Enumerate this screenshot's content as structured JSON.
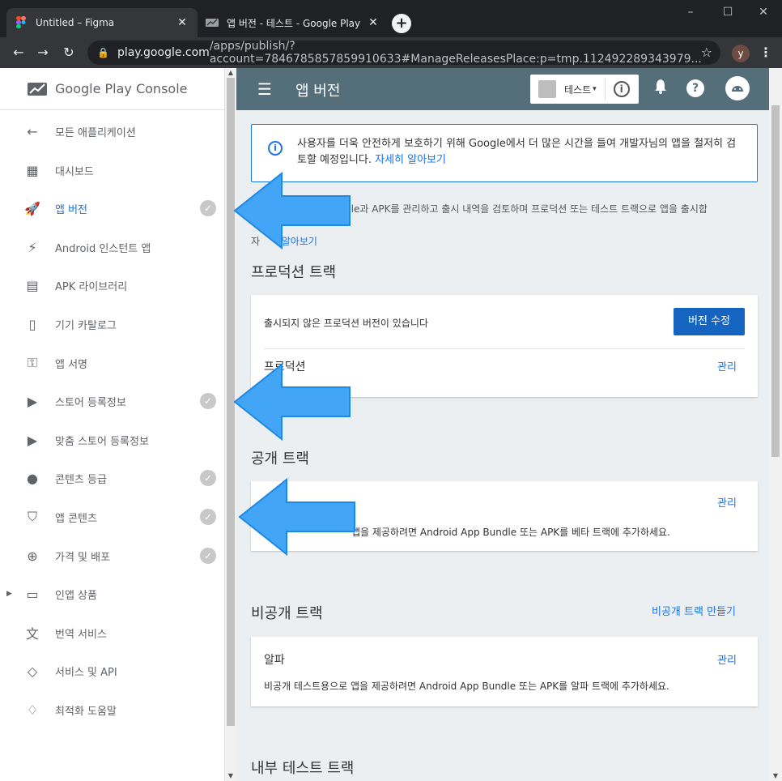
{
  "browser": {
    "tabs": [
      {
        "title": "Untitled – Figma",
        "active": true,
        "close": "✕"
      },
      {
        "title": "앱 버전 - 테스트 - Google Play",
        "active": false,
        "close": "✕"
      }
    ],
    "new_tab": "+",
    "window_controls": {
      "minimize": "–",
      "maximize": "☐",
      "close": "✕"
    },
    "nav": {
      "back": "←",
      "forward": "→",
      "reload": "↻"
    },
    "url": {
      "host": "play.google.com",
      "path": "/apps/publish/?account=7846785857859910633#ManageReleasesPlace:p=tmp.112492289343979..."
    },
    "star": "☆",
    "profile_initial": "y",
    "menu": "⋮"
  },
  "sidebar": {
    "brand": {
      "name": "Google Play",
      "suffix": " Console"
    },
    "items": [
      {
        "label": "모든 애플리케이션",
        "icon": "arrow-left-icon",
        "glyph": "←",
        "active": false,
        "check": false
      },
      {
        "label": "대시보드",
        "icon": "dashboard-icon",
        "glyph": "▦",
        "active": false,
        "check": false
      },
      {
        "label": "앱 버전",
        "icon": "rocket-icon",
        "glyph": "🚀",
        "active": true,
        "check": true
      },
      {
        "label": "Android 인스턴트 앱",
        "icon": "bolt-icon",
        "glyph": "⚡",
        "active": false,
        "check": false
      },
      {
        "label": "APK 라이브러리",
        "icon": "library-icon",
        "glyph": "▤",
        "active": false,
        "check": false
      },
      {
        "label": "기기 카탈로그",
        "icon": "device-icon",
        "glyph": "▯",
        "active": false,
        "check": false
      },
      {
        "label": "앱 서명",
        "icon": "key-icon",
        "glyph": "⚿",
        "active": false,
        "check": false
      },
      {
        "label": "스토어 등록정보",
        "icon": "store-icon",
        "glyph": "▶",
        "active": false,
        "check": true
      },
      {
        "label": "맞춤 스토어 등록정보",
        "icon": "custom-store-icon",
        "glyph": "▶",
        "active": false,
        "check": false
      },
      {
        "label": "콘텐츠 등급",
        "icon": "rating-icon",
        "glyph": "●",
        "active": false,
        "check": true
      },
      {
        "label": "앱 콘텐츠",
        "icon": "shield-icon",
        "glyph": "⛉",
        "active": false,
        "check": true
      },
      {
        "label": "가격 및 배포",
        "icon": "globe-icon",
        "glyph": "⊕",
        "active": false,
        "check": true
      },
      {
        "label": "인앱 상품",
        "icon": "card-icon",
        "glyph": "▭",
        "active": false,
        "check": false,
        "expandable": true
      },
      {
        "label": "번역 서비스",
        "icon": "translate-icon",
        "glyph": "文",
        "active": false,
        "check": false
      },
      {
        "label": "서비스 및 API",
        "icon": "api-icon",
        "glyph": "◇",
        "active": false,
        "check": false
      },
      {
        "label": "최적화 도움말",
        "icon": "lightbulb-icon",
        "glyph": "♢",
        "active": false,
        "check": false
      }
    ],
    "check_glyph": "✓",
    "expander_glyph": "▶"
  },
  "appbar": {
    "menu_glyph": "☰",
    "title": "앱 버전",
    "app_name": "테스트",
    "dropdown_glyph": "▾",
    "info_glyph": "i",
    "bell_glyph": "🔔",
    "help_glyph": "?"
  },
  "notice": {
    "text": "사용자를 더욱 안전하게 보호하기 위해 Google에서 더 많은 시간을 들여 개발자님의 앱을 철저히 검토할 예정입니다. ",
    "link": "자세히 알아보기",
    "icon_glyph": "i"
  },
  "description": {
    "text": "dle과 APK를 관리하고 출시 내역을 검토하며 프로덕션 또는 테스트 트랙으로 앱을 출시합",
    "prefix": "자",
    "link": "알아보기"
  },
  "production": {
    "title": "프로덕션 트랙",
    "unreleased_text": "출시되지 않은 프로덕션 버전이 있습니다",
    "edit_button": "버전 수정",
    "track_name": "프로덕션",
    "manage": "관리"
  },
  "open": {
    "title": "공개 트랙",
    "manage": "관리",
    "desc": "앱을 제공하려면 Android App Bundle 또는 APK를 베타 트랙에 추가하세요."
  },
  "closed": {
    "title": "비공개 트랙",
    "create": "비공개 트랙 만들기",
    "track_name": "알파",
    "manage": "관리",
    "desc": "비공개 테스트용으로 앱을 제공하려면 Android App Bundle 또는 APK를 알파 트랙에 추가하세요."
  },
  "internal": {
    "title": "내부 테스트 트랙"
  },
  "colors": {
    "appbar": "#546e7a",
    "accent": "#1a73e8",
    "arrow": "#42a5f5"
  }
}
